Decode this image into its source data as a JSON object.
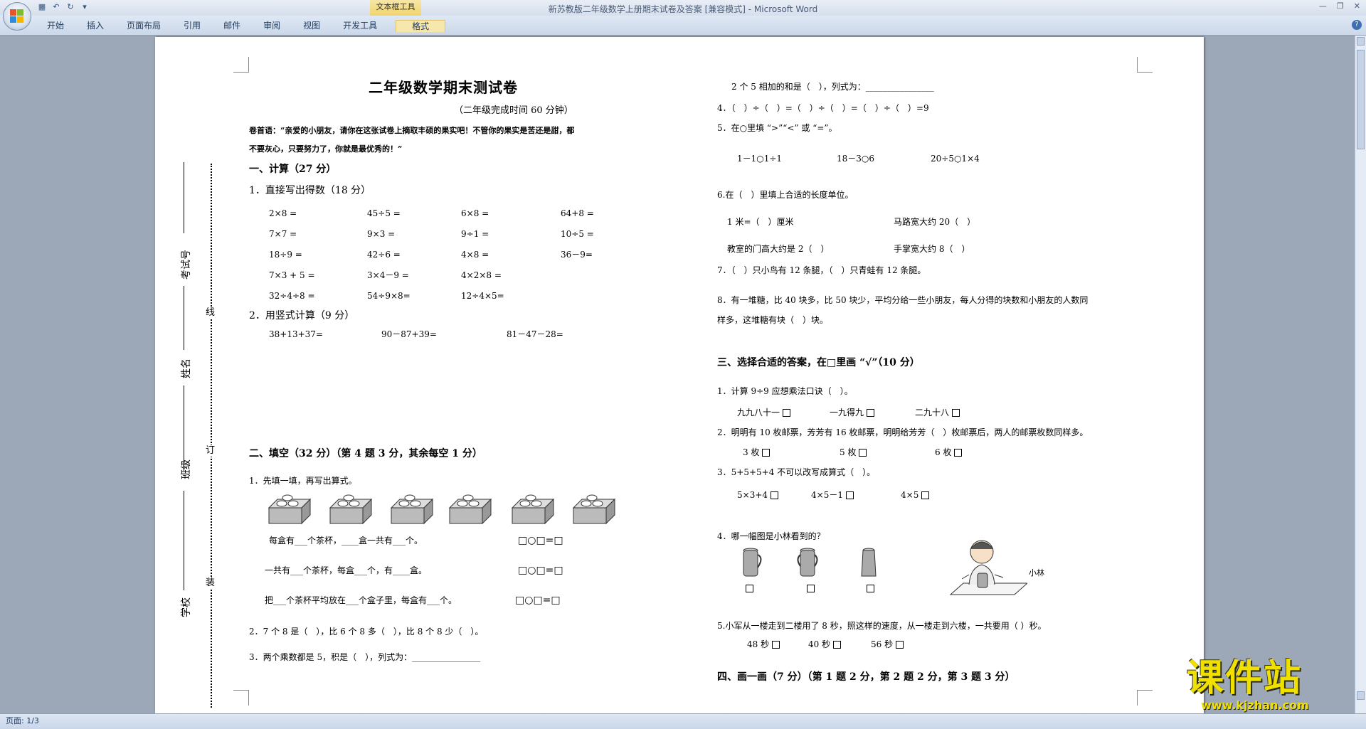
{
  "window": {
    "title": "新苏教版二年级数学上册期末试卷及答案 [兼容模式] - Microsoft Word",
    "context_tab_group": "文本框工具"
  },
  "ribbon": {
    "tabs": [
      "开始",
      "插入",
      "页面布局",
      "引用",
      "邮件",
      "审阅",
      "视图",
      "开发工具",
      "格式"
    ]
  },
  "statusbar": {
    "page": "页面: 1/3"
  },
  "left_column": {
    "title": "二年级数学期末测试卷",
    "subtitle": "（二年级完成时间 60 分钟）",
    "preface1": "卷首语：“亲爱的小朋友，请你在这张试卷上摘取丰硕的果实吧！不管你的果实是苦还是甜，都",
    "preface2": "不要灰心，只要努力了，你就是最优秀的！”",
    "sec1": "一、计算（27 分）",
    "sec1_q1": "1．直接写出得数（18 分）",
    "calc_rows": [
      [
        "2×8 =",
        "45÷5 =",
        "6×8 =",
        "64+8 ="
      ],
      [
        "7×7 =",
        "9×3 =",
        "9÷1 =",
        "10÷5 ="
      ],
      [
        "18÷9 =",
        "42÷6 =",
        "4×8 =",
        "36－9="
      ],
      [
        "7×3 + 5 =",
        "3×4－9 =",
        "4×2×8 =",
        ""
      ],
      [
        "32÷4÷8 =",
        "54÷9×8=",
        "12÷4×5=",
        ""
      ]
    ],
    "sec1_q2": "2．用竖式计算（9 分）",
    "vertical_calc": [
      "38+13+37=",
      "90－87+39=",
      "81－47－28="
    ],
    "sec2": "二、填空（32 分）（第 4 题 3 分，其余每空 1 分）",
    "fill_q1": "1．先填一填，再写出算式。",
    "fill_lines": [
      "每盒有___个茶杯，____盒一共有___个。",
      "一共有___个茶杯，每盒___个，有____盒。",
      "把___个茶杯平均放在___个盒子里，每盒有___个。"
    ],
    "equation_tpl": "□○□=□",
    "fill_q2": "2．7 个 8 是（　），比 6 个 8 多（　），比 8 个 8 少（　）。",
    "fill_q3": "3．两个乘数都是 5，积是（　），列式为：________________"
  },
  "margin": {
    "labels": [
      "考试号",
      "姓名",
      "班级",
      "学校"
    ],
    "seal_words": [
      "线",
      "订",
      "装"
    ]
  },
  "right_column": {
    "r1": "2 个 5 相加的和是（　），列式为：________________",
    "r2": "4．（　）÷（　）=（　）÷（　）=（　）÷（　）=9",
    "r3": "5．在○里填 “>”“<” 或 “=”。",
    "r4": [
      "1－1○1÷1",
      "18－3○6",
      "20÷5○1×4"
    ],
    "r5": "6.在（　）里填上合适的长度单位。",
    "r6a": "1 米=（　）厘米",
    "r6b": "马路宽大约 20（　）",
    "r7a": "教室的门高大约是 2（　）",
    "r7b": "手掌宽大约 8（　）",
    "r8": "7．（　）只小鸟有 12 条腿，（　）只青蛙有 12 条腿。",
    "r9a": "8．有一堆糖，比 40 块多，比 50 块少，平均分给一些小朋友，每人分得的块数和小朋友的人数同",
    "r9b": "样多，这堆糖有块（　）块。",
    "sec3": "三、选择合适的答案，在□里画 “√”（10 分）",
    "c1": "1．计算 9÷9 应想乘法口诀（　）。",
    "c1_opts": [
      "九九八十一",
      "一九得九",
      "二九十八"
    ],
    "c2": "2．明明有 10 枚邮票，芳芳有 16 枚邮票，明明给芳芳（　）枚邮票后，两人的邮票枚数同样多。",
    "c2_opts": [
      "3 枚",
      "5 枚",
      "6 枚"
    ],
    "c3": "3．5+5+5+4 不可以改写成算式（　）。",
    "c3_opts": [
      "5×3+4",
      "4×5－1",
      "4×5"
    ],
    "c4": "4．哪一幅图是小林看到的？",
    "c4_name": "小林",
    "c5": "5.小军从一楼走到二楼用了 8 秒，照这样的速度，从一楼走到六楼，一共要用（ ）秒。",
    "c5_opts": [
      "48 秒",
      "40 秒",
      "56 秒"
    ],
    "sec4": "四、画一画（7 分）（第 1 题 2 分，第 2 题 2 分，第 3 题 3 分）"
  },
  "watermark": {
    "text": "课件站",
    "url": "www.kjzhan.com"
  },
  "colors": {
    "ribbon": "#cbd8ea",
    "workspace": "#9ca8b8",
    "watermark": "#f0e000"
  }
}
